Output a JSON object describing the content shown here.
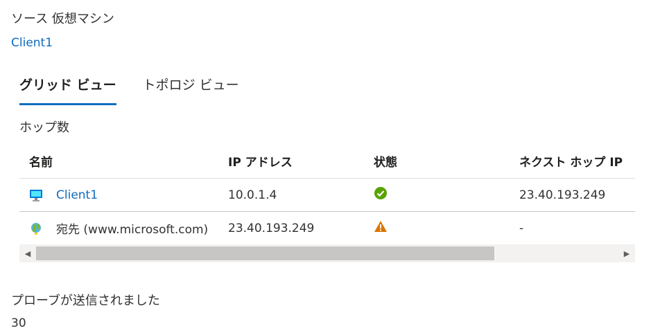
{
  "source": {
    "label": "ソース 仮想マシン",
    "vm_link": "Client1"
  },
  "tabs": [
    {
      "label": "グリッド ビュー",
      "active": true
    },
    {
      "label": "トポロジ ビュー",
      "active": false
    }
  ],
  "hops": {
    "label": "ホップ数",
    "columns": [
      "名前",
      "IP アドレス",
      "状態",
      "ネクスト ホップ IP"
    ],
    "rows": [
      {
        "icon": "virtual-machine-icon",
        "name": "Client1",
        "ip": "10.0.1.4",
        "state_icon": "success-check-icon",
        "next_hop_ip": "23.40.193.249"
      },
      {
        "icon": "globe-icon",
        "name": "宛先 (www.microsoft.com)",
        "ip": "23.40.193.249",
        "state_icon": "warning-triangle-icon",
        "next_hop_ip": "-"
      }
    ]
  },
  "scrollbar": {
    "left_arrow": "◀",
    "right_arrow": "▶"
  },
  "probes": {
    "label": "プローブが送信されました",
    "value": "30"
  },
  "colors": {
    "link": "#0f6cbd",
    "success": "#57a300",
    "warning": "#db7500"
  }
}
